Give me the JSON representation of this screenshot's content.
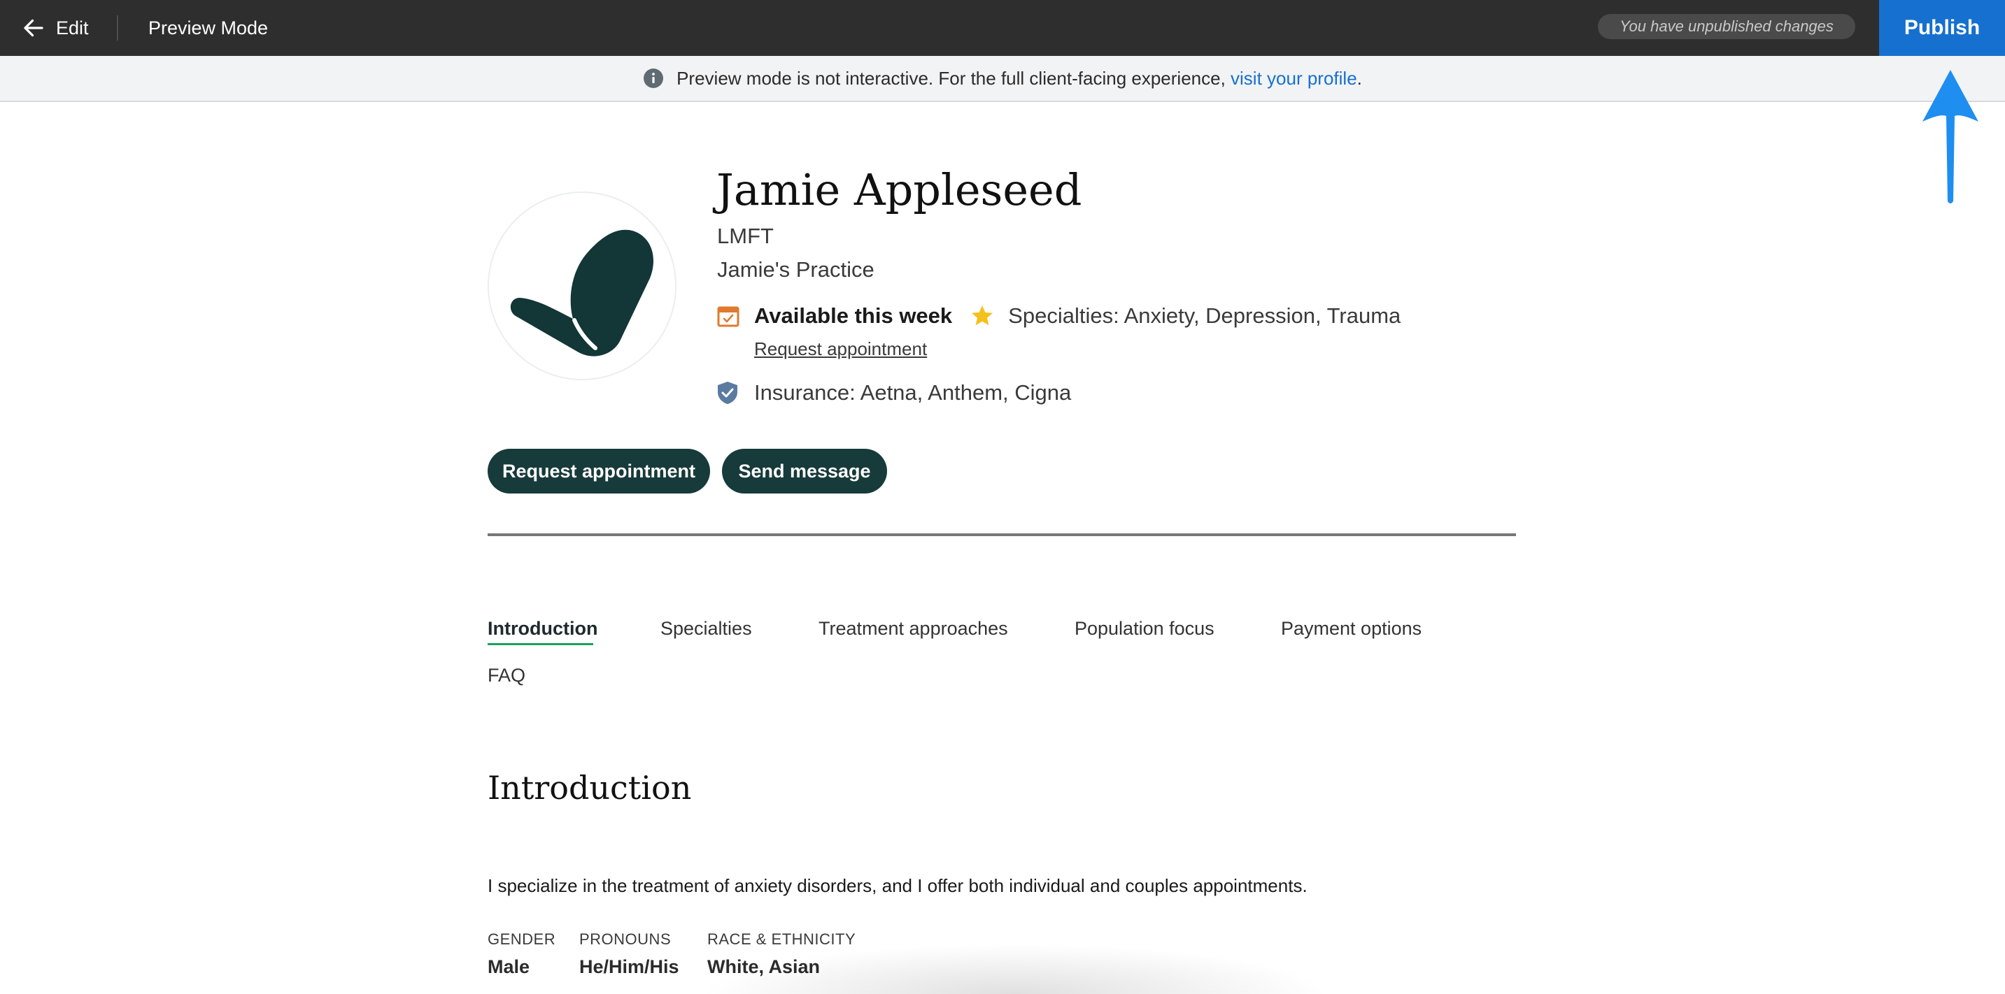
{
  "topbar": {
    "back_label": "Edit",
    "mode_label": "Preview Mode",
    "unpublished_notice": "You have unpublished changes",
    "publish_label": "Publish"
  },
  "banner": {
    "text": "Preview mode is not interactive. For the full client-facing experience,",
    "link_text": "visit your profile",
    "suffix": "."
  },
  "profile": {
    "name": "Jamie Appleseed",
    "credential": "LMFT",
    "practice": "Jamie's Practice",
    "availability": "Available this week",
    "specialties": "Specialties: Anxiety, Depression, Trauma",
    "request_link": "Request appointment",
    "insurance": "Insurance: Aetna, Anthem, Cigna"
  },
  "actions": {
    "request_label": "Request appointment",
    "message_label": "Send message"
  },
  "tabs": [
    {
      "label": "Introduction",
      "active": true
    },
    {
      "label": "Specialties"
    },
    {
      "label": "Treatment approaches"
    },
    {
      "label": "Population focus"
    },
    {
      "label": "Payment options"
    },
    {
      "label": "FAQ"
    }
  ],
  "introduction": {
    "title": "Introduction",
    "text": "I specialize in the treatment of anxiety disorders, and I offer both individual and couples appointments."
  },
  "details": [
    {
      "label": "GENDER",
      "value": "Male"
    },
    {
      "label": "PRONOUNS",
      "value": "He/Him/His"
    },
    {
      "label": "RACE & ETHNICITY",
      "value": "White, Asian"
    }
  ],
  "colors": {
    "topbar": "#2e2e2e",
    "publish": "#1670cf",
    "brand_dark": "#173a3a",
    "tab_active_underline": "#1aa35a",
    "calendar_icon": "#e07a2e",
    "star_icon": "#f5c01a",
    "shield_icon": "#5a7aa0",
    "annotation_arrow": "#1e8ef0"
  },
  "icons": {
    "back": "arrow-left-icon",
    "info": "info-icon",
    "calendar": "calendar-check-icon",
    "star": "star-icon",
    "insurance": "shield-check-icon"
  }
}
